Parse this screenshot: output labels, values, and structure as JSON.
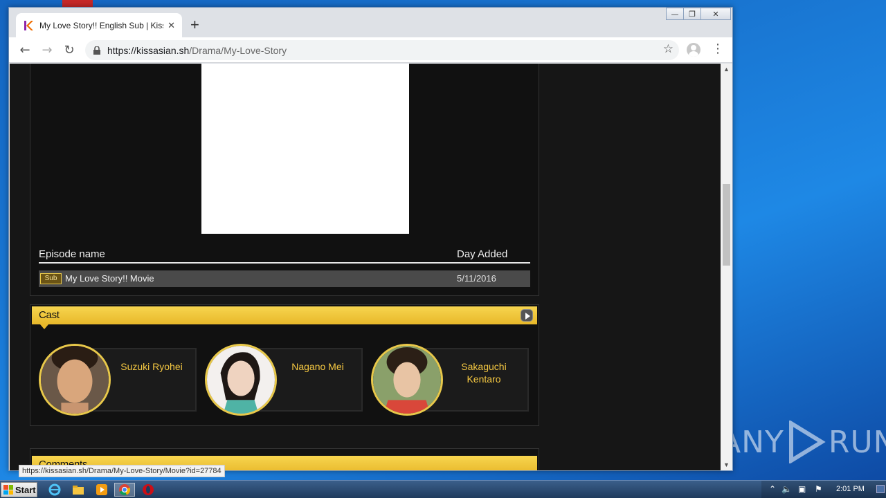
{
  "browser": {
    "tab_title": "My Love Story!! English Sub | KissAsian",
    "url_host": "https://kissasian.sh",
    "url_path": "/Drama/My-Love-Story",
    "status_url": "https://kissasian.sh/Drama/My-Love-Story/Movie?id=27784"
  },
  "episodes": {
    "header_name": "Episode name",
    "header_date": "Day Added",
    "rows": [
      {
        "badge": "Sub",
        "title": "My Love Story!! Movie",
        "date": "5/11/2016"
      }
    ]
  },
  "cast": {
    "title": "Cast",
    "members": [
      {
        "name": "Suzuki Ryohei"
      },
      {
        "name": "Nagano Mei"
      },
      {
        "name": "Sakaguchi Kentaro"
      }
    ]
  },
  "comments": {
    "title": "Comments"
  },
  "watermark": {
    "text": "ANY RUN"
  },
  "taskbar": {
    "start_label": "Start",
    "clock": "2:01 PM"
  },
  "colors": {
    "accent_yellow": "#f5c842",
    "page_bg": "#161616"
  }
}
